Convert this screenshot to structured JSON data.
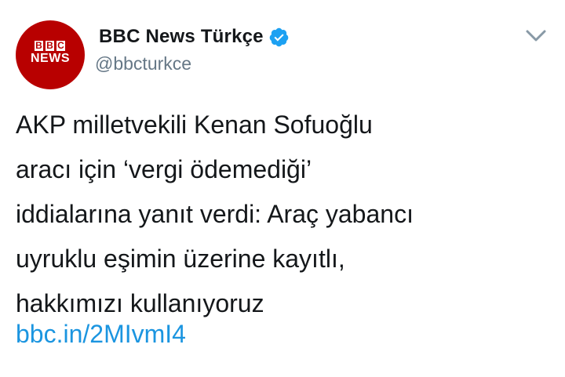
{
  "tweet": {
    "avatar": {
      "logo_letters": [
        "B",
        "B",
        "C"
      ],
      "logo_word": "NEWS",
      "brand_color": "#b80000"
    },
    "author": {
      "display_name": "BBC News Türkçe",
      "handle": "@bbcturkce",
      "verified": true,
      "verified_icon": "verified-badge-icon",
      "verified_color": "#1da1f2"
    },
    "menu_icon": "chevron-down-icon",
    "text": "AKP milletvekili Kenan Sofuoğlu\naracı için ‘vergi ödemediği’\niddialarına yanıt verdi: Araç yabancı\nuyruklu eşimin üzerine kayıtlı,\nhakkımızı kullanıyoruz",
    "link": "bbc.in/2MIvmI4",
    "colors": {
      "text": "#14171a",
      "secondary": "#657786",
      "link": "#1b95e0"
    }
  }
}
